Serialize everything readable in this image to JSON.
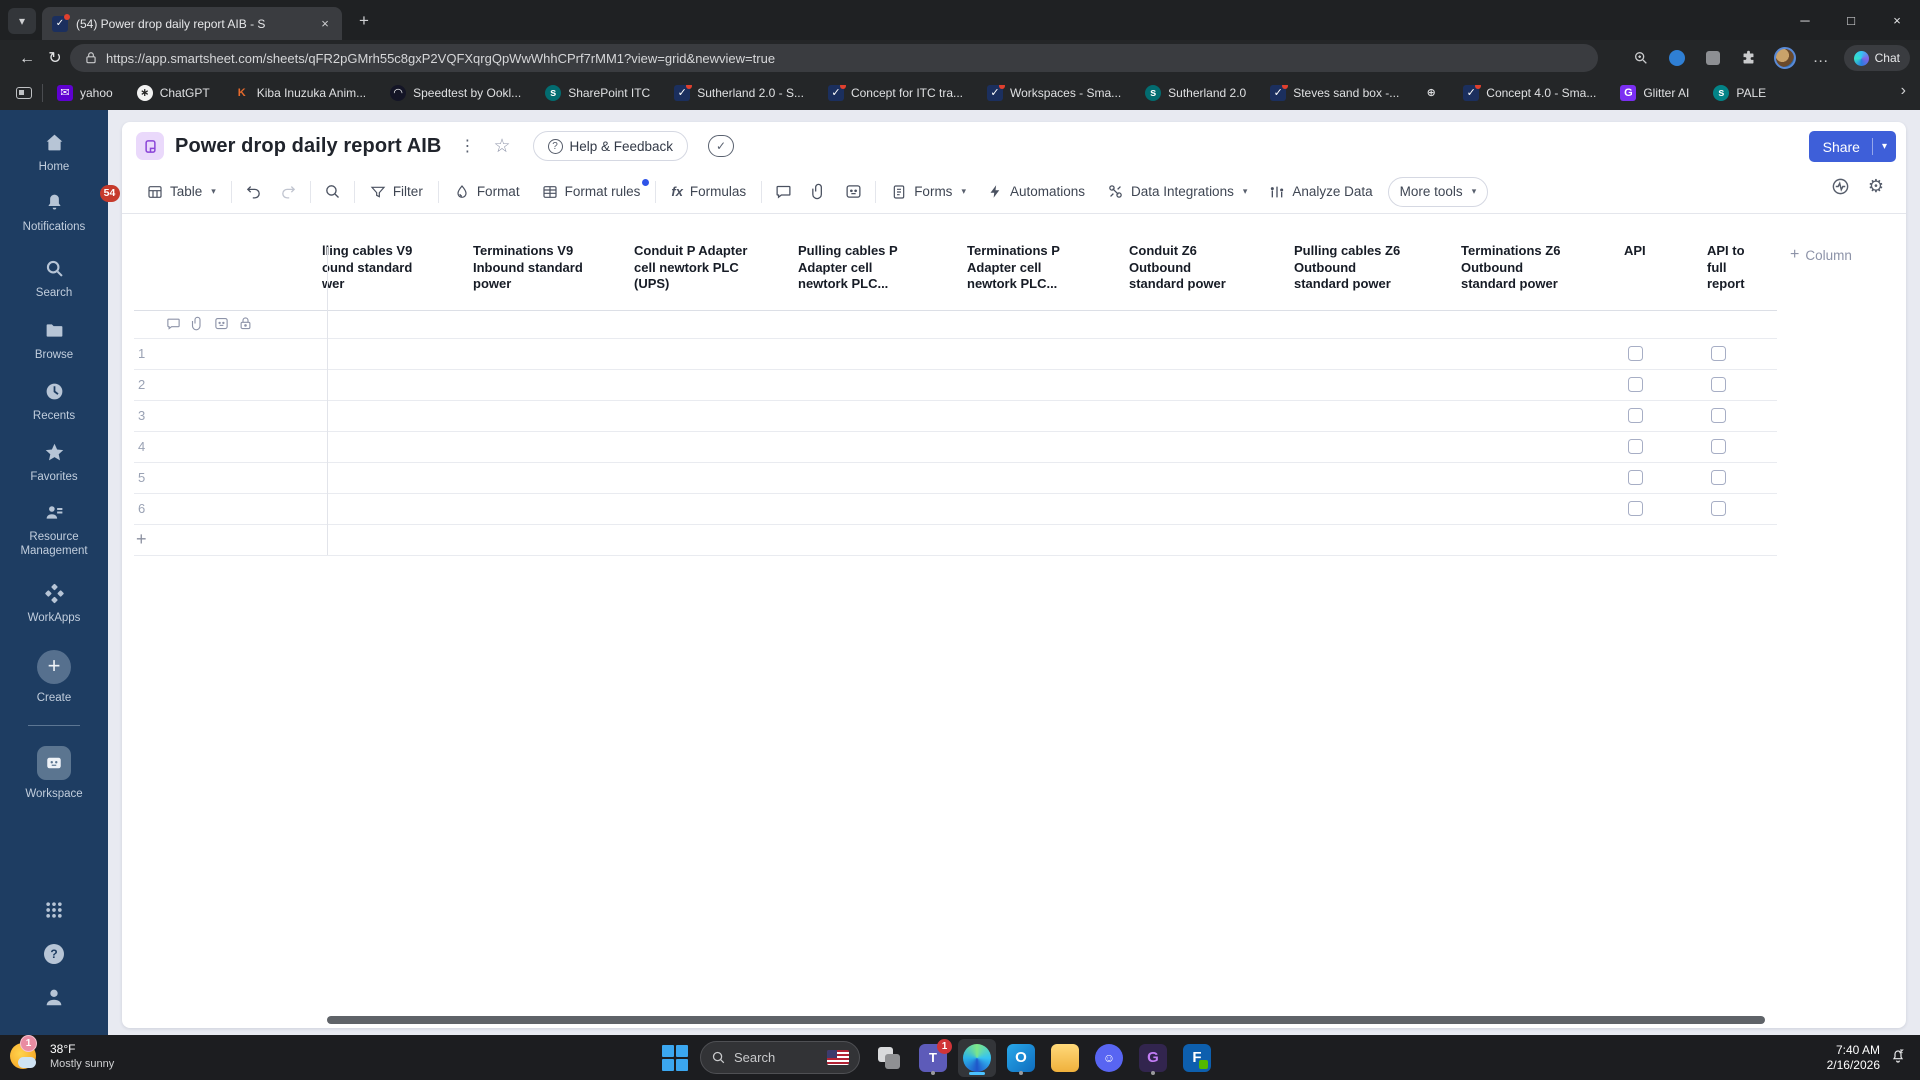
{
  "glyphs": {
    "chevron_down": "▾",
    "chevron_right": "›",
    "kebab": "⋮",
    "star": "☆",
    "check": "✓",
    "question": "?",
    "gear": "⚙",
    "ellipsis": "…",
    "minimize": "─",
    "maximize": "□",
    "close": "×",
    "plus": "+",
    "back": "←",
    "refresh": "↻",
    "fx": "fx"
  },
  "browser": {
    "tab": {
      "title": "(54) Power drop daily report AIB - S"
    },
    "url": "https://app.smartsheet.com/sheets/qFR2pGMrh55c8gxP2VQFXqrgQpWwWhhCPrf7rMM1?view=grid&newview=true",
    "chat_label": "Chat",
    "favicon_glyphs": {
      "smartsheet": "✓",
      "yahoo": "✉",
      "chatgpt": "∗",
      "kiba": "K",
      "speedtest": "◠",
      "sharepoint": "s",
      "globe": "⊕",
      "glitter": "G",
      "pale": "s"
    },
    "favicon_styles": {
      "smartsheet": {
        "bg": "#1b2f5e",
        "fg": "#ffffff",
        "shape": "square",
        "dot": true
      },
      "yahoo": {
        "bg": "#5f01d1",
        "fg": "#ffffff",
        "shape": "square"
      },
      "chatgpt": {
        "bg": "#f2f2f2",
        "fg": "#222222",
        "shape": "circle"
      },
      "kiba": {
        "bg": "transparent",
        "fg": "#e66a2c",
        "shape": "square"
      },
      "speedtest": {
        "bg": "#141526",
        "fg": "#ffffff",
        "shape": "circle"
      },
      "sharepoint": {
        "bg": "#036c70",
        "fg": "#ffffff",
        "shape": "circle"
      },
      "globe": {
        "bg": "transparent",
        "fg": "#d9dadc",
        "shape": "circle"
      },
      "glitter": {
        "bg": "#7b2ff2",
        "fg": "#ffffff",
        "shape": "square"
      },
      "pale": {
        "bg": "#038387",
        "fg": "#ffffff",
        "shape": "circle"
      }
    },
    "bookmarks": [
      {
        "label": "yahoo",
        "icon": "yahoo"
      },
      {
        "label": "ChatGPT",
        "icon": "chatgpt"
      },
      {
        "label": "Kiba Inuzuka Anim...",
        "icon": "kiba"
      },
      {
        "label": "Speedtest by Ookl...",
        "icon": "speedtest"
      },
      {
        "label": "SharePoint ITC",
        "icon": "sharepoint"
      },
      {
        "label": "Sutherland 2.0 - S...",
        "icon": "smartsheet"
      },
      {
        "label": "Concept for ITC tra...",
        "icon": "smartsheet"
      },
      {
        "label": "Workspaces - Sma...",
        "icon": "smartsheet"
      },
      {
        "label": "Sutherland 2.0",
        "icon": "sharepoint"
      },
      {
        "label": "Steves sand box -...",
        "icon": "smartsheet"
      },
      {
        "label": "",
        "icon": "globe"
      },
      {
        "label": "Concept 4.0 - Sma...",
        "icon": "smartsheet"
      },
      {
        "label": "Glitter AI",
        "icon": "glitter"
      },
      {
        "label": "PALE",
        "icon": "pale"
      }
    ]
  },
  "sidebar": {
    "items": [
      {
        "id": "home",
        "label": "Home"
      },
      {
        "id": "notifications",
        "label": "Notifications",
        "badge": "54"
      },
      {
        "id": "search",
        "label": "Search"
      },
      {
        "id": "browse",
        "label": "Browse"
      },
      {
        "id": "recents",
        "label": "Recents"
      },
      {
        "id": "favorites",
        "label": "Favorites"
      },
      {
        "id": "resource-management",
        "label": "Resource Management"
      },
      {
        "id": "workapps",
        "label": "WorkApps"
      },
      {
        "id": "create",
        "label": "Create"
      },
      {
        "id": "workspace",
        "label": "Workspace"
      }
    ]
  },
  "sheet": {
    "title": "Power drop daily report AIB",
    "help_feedback": "Help & Feedback",
    "share": "Share",
    "toolbar": {
      "view": "Table",
      "filter": "Filter",
      "format": "Format",
      "format_rules": "Format rules",
      "formulas": "Formulas",
      "forms": "Forms",
      "automations": "Automations",
      "data_integrations": "Data Integrations",
      "analyze_data": "Analyze Data",
      "more_tools": "More tools"
    },
    "grid": {
      "columns": [
        {
          "lines": [
            "lling cables V9",
            "ound standard",
            "wer"
          ]
        },
        {
          "lines": [
            "Terminations V9",
            "Inbound standard",
            "power"
          ]
        },
        {
          "lines": [
            "Conduit P Adapter",
            "cell newtork PLC",
            "(UPS)"
          ]
        },
        {
          "lines": [
            "Pulling cables P",
            "Adapter cell",
            "newtork PLC..."
          ]
        },
        {
          "lines": [
            "Terminations P",
            "Adapter cell",
            "newtork PLC..."
          ]
        },
        {
          "lines": [
            "Conduit Z6",
            "Outbound",
            "standard power"
          ]
        },
        {
          "lines": [
            "Pulling cables Z6",
            "Outbound",
            "standard power"
          ]
        },
        {
          "lines": [
            "Terminations Z6",
            "Outbound",
            "standard power"
          ]
        },
        {
          "lines": [
            "API"
          ],
          "type": "checkbox"
        },
        {
          "lines": [
            "API to",
            "full",
            "report"
          ],
          "type": "checkbox"
        }
      ],
      "row_numbers": [
        "1",
        "2",
        "3",
        "4",
        "5",
        "6"
      ],
      "checkbox_checked": false,
      "add_column_label": "Column"
    }
  },
  "taskbar": {
    "weather": {
      "temp": "38°F",
      "condition": "Mostly sunny",
      "badge": "1"
    },
    "search_placeholder": "Search",
    "teams_badge": "1",
    "clock": {
      "time": "7:40 AM",
      "date": "2/16/2026"
    }
  }
}
